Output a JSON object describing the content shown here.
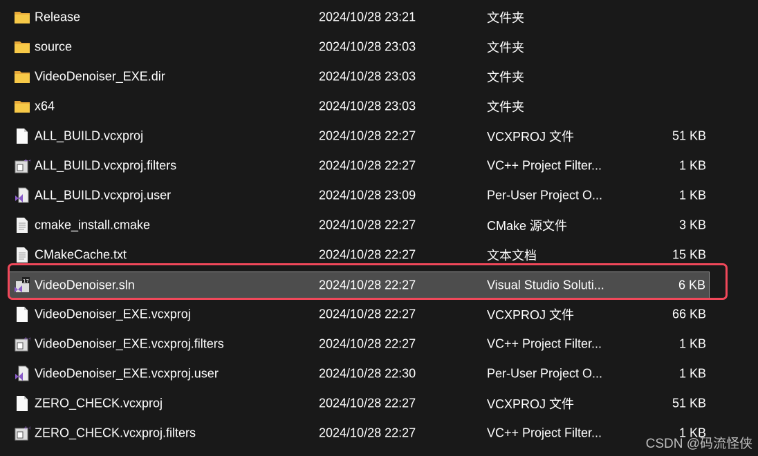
{
  "files": [
    {
      "name": "Release",
      "date": "2024/10/28 23:21",
      "type": "文件夹",
      "size": "",
      "icon": "folder"
    },
    {
      "name": "source",
      "date": "2024/10/28 23:03",
      "type": "文件夹",
      "size": "",
      "icon": "folder"
    },
    {
      "name": "VideoDenoiser_EXE.dir",
      "date": "2024/10/28 23:03",
      "type": "文件夹",
      "size": "",
      "icon": "folder"
    },
    {
      "name": "x64",
      "date": "2024/10/28 23:03",
      "type": "文件夹",
      "size": "",
      "icon": "folder"
    },
    {
      "name": "ALL_BUILD.vcxproj",
      "date": "2024/10/28 22:27",
      "type": "VCXPROJ 文件",
      "size": "51 KB",
      "icon": "blank-file"
    },
    {
      "name": "ALL_BUILD.vcxproj.filters",
      "date": "2024/10/28 22:27",
      "type": "VC++ Project Filter...",
      "size": "1 KB",
      "icon": "filters-file"
    },
    {
      "name": "ALL_BUILD.vcxproj.user",
      "date": "2024/10/28 23:09",
      "type": "Per-User Project O...",
      "size": "1 KB",
      "icon": "vs-user-file"
    },
    {
      "name": "cmake_install.cmake",
      "date": "2024/10/28 22:27",
      "type": "CMake 源文件",
      "size": "3 KB",
      "icon": "text-file"
    },
    {
      "name": "CMakeCache.txt",
      "date": "2024/10/28 22:27",
      "type": "文本文档",
      "size": "15 KB",
      "icon": "text-file"
    },
    {
      "name": "VideoDenoiser.sln",
      "date": "2024/10/28 22:27",
      "type": "Visual Studio Soluti...",
      "size": "6 KB",
      "icon": "vs-solution",
      "selected": true
    },
    {
      "name": "VideoDenoiser_EXE.vcxproj",
      "date": "2024/10/28 22:27",
      "type": "VCXPROJ 文件",
      "size": "66 KB",
      "icon": "blank-file"
    },
    {
      "name": "VideoDenoiser_EXE.vcxproj.filters",
      "date": "2024/10/28 22:27",
      "type": "VC++ Project Filter...",
      "size": "1 KB",
      "icon": "filters-file"
    },
    {
      "name": "VideoDenoiser_EXE.vcxproj.user",
      "date": "2024/10/28 22:30",
      "type": "Per-User Project O...",
      "size": "1 KB",
      "icon": "vs-user-file"
    },
    {
      "name": "ZERO_CHECK.vcxproj",
      "date": "2024/10/28 22:27",
      "type": "VCXPROJ 文件",
      "size": "51 KB",
      "icon": "blank-file"
    },
    {
      "name": "ZERO_CHECK.vcxproj.filters",
      "date": "2024/10/28 22:27",
      "type": "VC++ Project Filter...",
      "size": "1 KB",
      "icon": "filters-file"
    }
  ],
  "vs_version_badge": "17",
  "watermark": "CSDN @码流怪侠",
  "colors": {
    "background": "#191919",
    "selected_row": "#4d4d4d",
    "highlight_box": "#f0485a",
    "folder": "#f4c24d",
    "vs_purple": "#8a5cc8"
  }
}
